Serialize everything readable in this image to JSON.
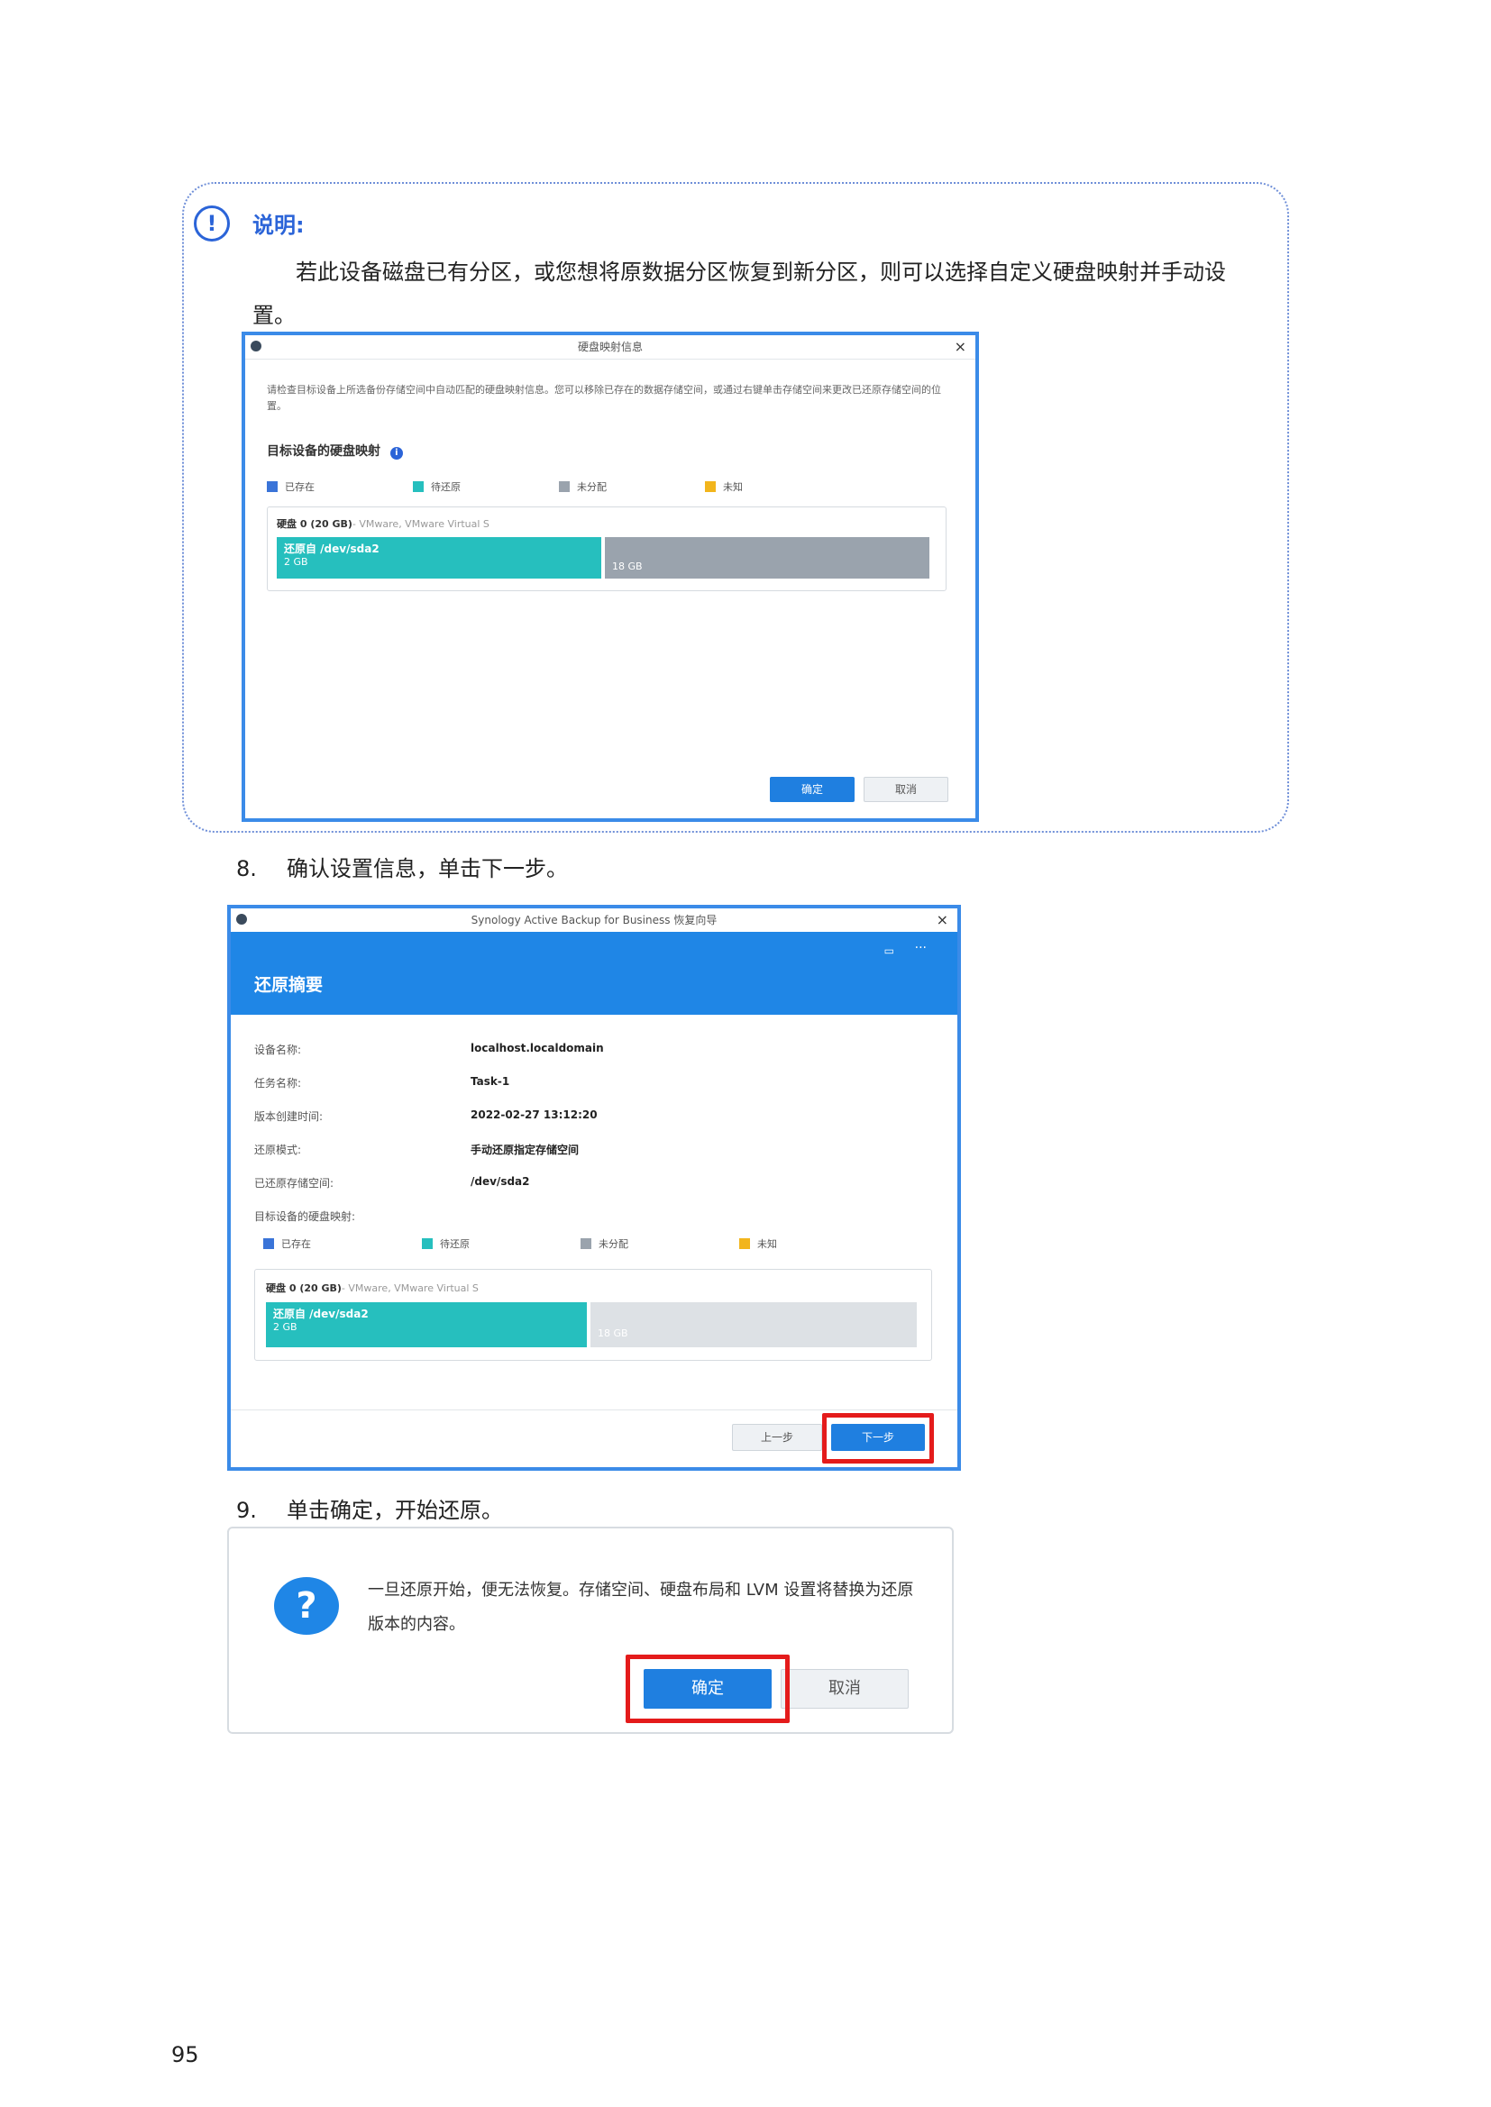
{
  "note": {
    "icon": "exclamation-circle-icon",
    "title": "说明:",
    "text": "若此设备磁盘已有分区，或您想将原数据分区恢复到新分区，则可以选择自定义硬盘映射并手动设置。"
  },
  "window1": {
    "title": "硬盘映射信息",
    "description": "请检查目标设备上所选备份存储空间中自动匹配的硬盘映射信息。您可以移除已存在的数据存储空间，或通过右键单击存储空间来更改已还原存储空间的位置。",
    "heading": "目标设备的硬盘映射",
    "legend": [
      "已存在",
      "待还原",
      "未分配",
      "未知"
    ],
    "disk_label": "硬盘 0 (20 GB)",
    "disk_model": "- VMware, VMware Virtual S",
    "partition_title": "还原自 /dev/sda2",
    "partition_size": "2 GB",
    "free_size": "18 GB",
    "ok": "确定",
    "cancel": "取消"
  },
  "step8": {
    "num": "8.",
    "text": "确认设置信息，单击下一步。"
  },
  "window2": {
    "title": "Synology Active Backup for Business 恢复向导",
    "header": "还原摘要",
    "fields": [
      {
        "k": "设备名称:",
        "v": "localhost.localdomain"
      },
      {
        "k": "任务名称:",
        "v": "Task-1"
      },
      {
        "k": "版本创建时间:",
        "v": "2022-02-27 13:12:20"
      },
      {
        "k": "还原模式:",
        "v": "手动还原指定存储空间"
      },
      {
        "k": "已还原存储空间:",
        "v": "/dev/sda2"
      }
    ],
    "mapping_label": "目标设备的硬盘映射:",
    "legend": [
      "已存在",
      "待还原",
      "未分配",
      "未知"
    ],
    "disk_label": "硬盘 0 (20 GB)",
    "disk_model": "- VMware, VMware Virtual S",
    "partition_title": "还原自 /dev/sda2",
    "partition_size": "2 GB",
    "free_size": "18 GB",
    "prev": "上一步",
    "next": "下一步"
  },
  "step9": {
    "num": "9.",
    "text": "单击确定，开始还原。"
  },
  "dialog": {
    "message_line1": "一旦还原开始，便无法恢复。存储空间、硬盘布局和 LVM 设置将替换为还原",
    "message_line2": "版本的内容。",
    "ok": "确定",
    "cancel": "取消"
  },
  "colors": {
    "existing": "#3a74d8",
    "to_restore": "#26bfbe",
    "unallocated": "#9aa3ad",
    "unknown": "#f2b51c"
  },
  "page_number": "95"
}
